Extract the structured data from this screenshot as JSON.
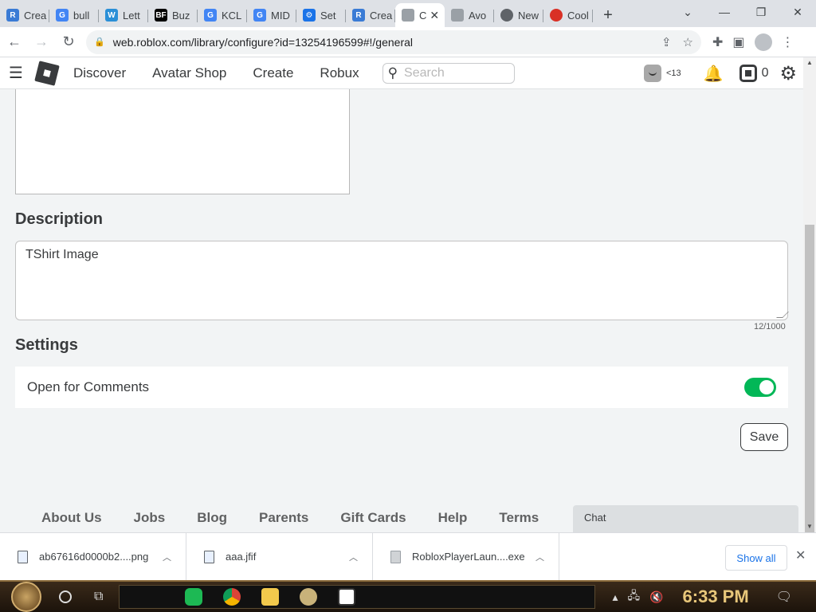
{
  "browser": {
    "tabs": [
      {
        "label": "Crea",
        "icon_color": "#3a7bd5",
        "icon": "roblox-studio-icon"
      },
      {
        "label": "bull",
        "icon_color": "#4285f4",
        "icon": "google-icon"
      },
      {
        "label": "Lett",
        "icon_color": "#2a8fd7",
        "icon": "w-icon"
      },
      {
        "label": "Buz",
        "icon_color": "#000000",
        "icon": "bf-icon"
      },
      {
        "label": "KCL",
        "icon_color": "#4285f4",
        "icon": "google-icon"
      },
      {
        "label": "MID",
        "icon_color": "#4285f4",
        "icon": "google-icon"
      },
      {
        "label": "Set",
        "icon_color": "#1a73e8",
        "icon": "gear-icon"
      },
      {
        "label": "Crea",
        "icon_color": "#3a7bd5",
        "icon": "roblox-studio-icon"
      },
      {
        "label": "C",
        "icon_color": "#9aa0a6",
        "icon": "roblox-icon",
        "active": true
      },
      {
        "label": "Avo",
        "icon_color": "#9aa0a6",
        "icon": "roblox-icon"
      },
      {
        "label": "New",
        "icon_color": "#5f6368",
        "icon": "chrome-icon"
      },
      {
        "label": "Cool",
        "icon_color": "#d93025",
        "icon": "cool-icon"
      }
    ],
    "url": "web.roblox.com/library/configure?id=13254196599#!/general"
  },
  "nav": {
    "links": [
      "Discover",
      "Avatar Shop",
      "Create",
      "Robux"
    ],
    "search_placeholder": "Search",
    "age_badge": "<13",
    "robux_count": "0"
  },
  "content": {
    "description_heading": "Description",
    "description_value": "TShirt Image",
    "char_count": "12/1000",
    "settings_heading": "Settings",
    "comments_label": "Open for Comments",
    "comments_enabled": true,
    "save_label": "Save"
  },
  "footer": {
    "links": [
      "About Us",
      "Jobs",
      "Blog",
      "Parents",
      "Gift Cards",
      "Help",
      "Terms"
    ],
    "chat_label": "Chat"
  },
  "downloads": {
    "items": [
      "ab67616d0000b2....png",
      "aaa.jfif",
      "RobloxPlayerLaun....exe"
    ],
    "show_all": "Show all"
  },
  "taskbar": {
    "time": "6:33 PM"
  },
  "colors": {
    "toggle_on": "#02b757",
    "link_blue": "#1a73e8"
  }
}
